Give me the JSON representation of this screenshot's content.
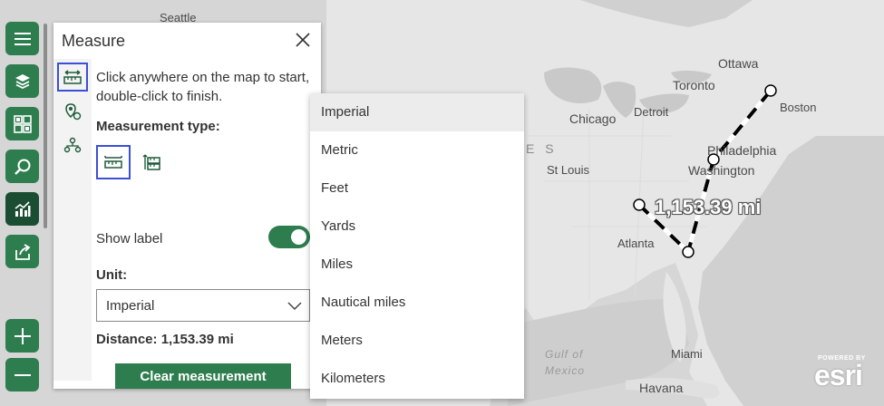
{
  "map": {
    "labels": {
      "seattle": "Seattle",
      "ottawa": "Ottawa",
      "toronto": "Toronto",
      "boston": "Boston",
      "chicago": "Chicago",
      "detroit": "Detroit",
      "philadelphia": "Philadelphia",
      "washington": "Washington",
      "st_louis": "St Louis",
      "atlanta": "Atlanta",
      "miami": "Miami",
      "havana": "Havana",
      "gulf": "Gulf of",
      "mexico": "Mexico",
      "region_partial": "E S"
    },
    "measurement_label": "1,153.39 mi"
  },
  "toolbar": {
    "items": [
      {
        "name": "menu-icon"
      },
      {
        "name": "layers-icon"
      },
      {
        "name": "basemap-gallery-icon"
      },
      {
        "name": "search-icon"
      },
      {
        "name": "analysis-icon"
      },
      {
        "name": "share-icon"
      }
    ],
    "zoom_in": "+",
    "zoom_out": "−"
  },
  "measure": {
    "title": "Measure",
    "instructions": "Click anywhere on the map to start, double-click to finish.",
    "measurement_type_label": "Measurement type:",
    "show_label": "Show label",
    "show_label_on": true,
    "unit_label": "Unit:",
    "unit_value": "Imperial",
    "distance": "Distance: 1,153.39 mi",
    "clear_button": "Clear measurement"
  },
  "unit_options": [
    "Imperial",
    "Metric",
    "Feet",
    "Yards",
    "Miles",
    "Nautical miles",
    "Meters",
    "Kilometers"
  ],
  "brand": {
    "powered_by": "POWERED BY",
    "esri": "esri"
  },
  "colors": {
    "accent": "#2e7d4f",
    "selection_border": "#3b4fd9"
  }
}
